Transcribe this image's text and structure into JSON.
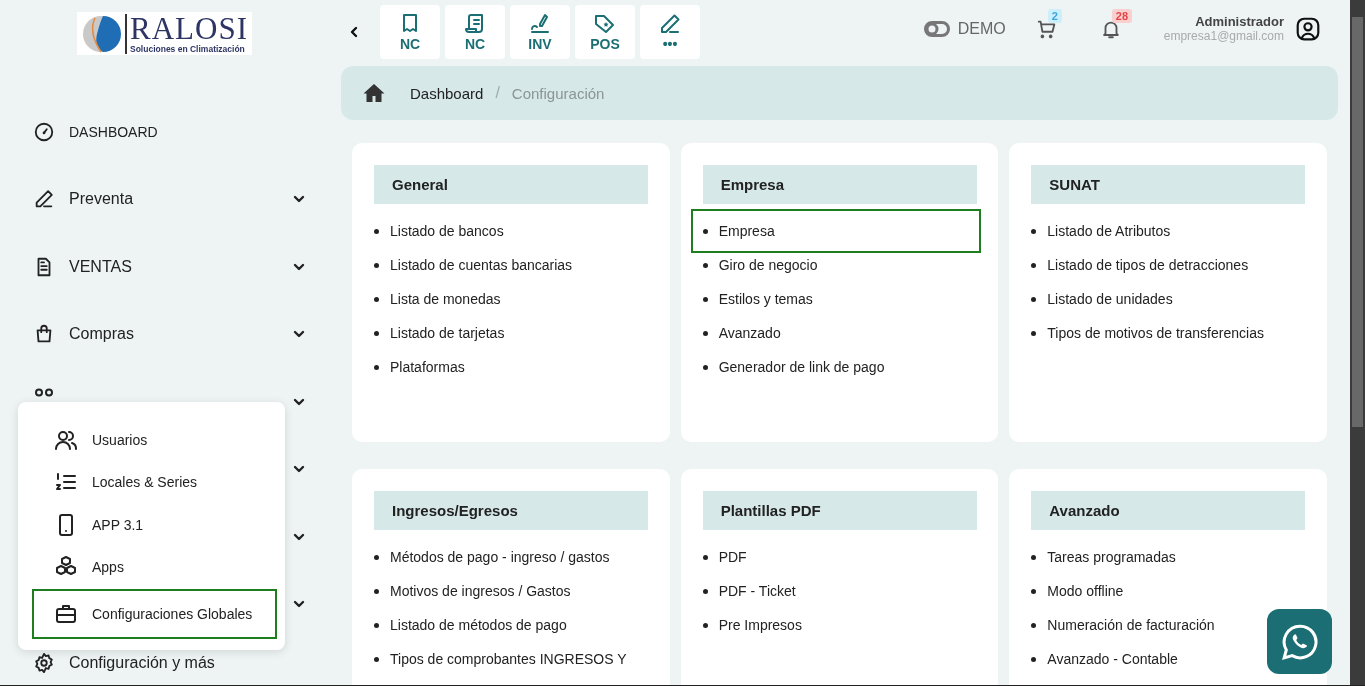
{
  "logo": {
    "title": "RALOSI",
    "subtitle": "Soluciones en Climatización"
  },
  "toolbar": {
    "buttons": [
      {
        "label": "NC"
      },
      {
        "label": "NC"
      },
      {
        "label": "INV"
      },
      {
        "label": "POS"
      },
      {
        "label": "•••"
      }
    ]
  },
  "header": {
    "demo": {
      "label": "DEMO",
      "on": false
    },
    "cart_count": "2",
    "notification_count": "28",
    "user": {
      "name": "Administrador",
      "email": "empresa1@gmail.com"
    }
  },
  "sidebar": {
    "items": [
      {
        "label": "DASHBOARD",
        "expandable": false
      },
      {
        "label": "Preventa",
        "expandable": true
      },
      {
        "label": "VENTAS",
        "expandable": true
      },
      {
        "label": "Compras",
        "expandable": true
      },
      {
        "expandable": true
      },
      {
        "expandable": true
      },
      {
        "expandable": true
      },
      {
        "expandable": true
      },
      {
        "label": "Configuración y más",
        "expandable": false
      }
    ]
  },
  "popup_menu": {
    "items": [
      {
        "label": "Usuarios",
        "selected": false
      },
      {
        "label": "Locales & Series",
        "selected": false
      },
      {
        "label": "APP 3.1",
        "selected": false
      },
      {
        "label": "Apps",
        "selected": false
      },
      {
        "label": "Configuraciones Globales",
        "selected": true
      }
    ]
  },
  "breadcrumb": {
    "separator": "/",
    "items": [
      "Dashboard",
      "Configuración"
    ]
  },
  "cards": [
    {
      "title": "General",
      "links": [
        {
          "label": "Listado de bancos",
          "selected": false
        },
        {
          "label": "Listado de cuentas bancarias",
          "selected": false
        },
        {
          "label": "Lista de monedas",
          "selected": false
        },
        {
          "label": "Listado de tarjetas",
          "selected": false
        },
        {
          "label": "Plataformas",
          "selected": false
        }
      ]
    },
    {
      "title": "Empresa",
      "links": [
        {
          "label": "Empresa",
          "selected": true
        },
        {
          "label": "Giro de negocio",
          "selected": false
        },
        {
          "label": "Estilos y temas",
          "selected": false
        },
        {
          "label": "Avanzado",
          "selected": false
        },
        {
          "label": "Generador de link de pago",
          "selected": false
        }
      ]
    },
    {
      "title": "SUNAT",
      "links": [
        {
          "label": "Listado de Atributos",
          "selected": false
        },
        {
          "label": "Listado de tipos de detracciones",
          "selected": false
        },
        {
          "label": "Listado de unidades",
          "selected": false
        },
        {
          "label": "Tipos de motivos de transferencias",
          "selected": false
        }
      ]
    },
    {
      "title": "Ingresos/Egresos",
      "links": [
        {
          "label": "Métodos de pago - ingreso / gastos",
          "selected": false
        },
        {
          "label": "Motivos de ingresos / Gastos",
          "selected": false
        },
        {
          "label": "Listado de métodos de pago",
          "selected": false
        },
        {
          "label": "Tipos de comprobantes INGRESOS Y",
          "selected": false
        }
      ]
    },
    {
      "title": "Plantillas PDF",
      "links": [
        {
          "label": "PDF",
          "selected": false
        },
        {
          "label": "PDF - Ticket",
          "selected": false
        },
        {
          "label": "Pre Impresos",
          "selected": false
        }
      ]
    },
    {
      "title": "Avanzado",
      "links": [
        {
          "label": "Tareas programadas",
          "selected": false
        },
        {
          "label": "Modo offline",
          "selected": false
        },
        {
          "label": "Numeración de facturación",
          "selected": false
        },
        {
          "label": "Avanzado - Contable",
          "selected": false
        }
      ]
    }
  ]
}
